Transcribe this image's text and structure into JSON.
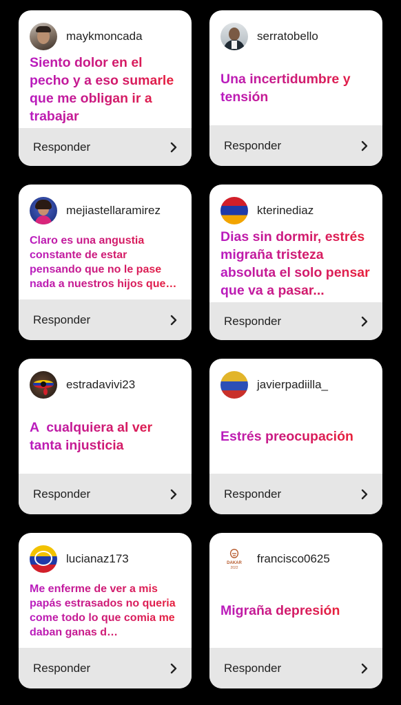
{
  "reply_label": "Responder",
  "accent_gradient": [
    "#b81bc0",
    "#d11a6c",
    "#e8213a"
  ],
  "cards": [
    {
      "username": "maykmoncada",
      "message": "Siento dolor en el pecho y a eso sumarle que me obligan ir a trabajar",
      "avatar_icon": "user-photo"
    },
    {
      "username": "serratobello",
      "message": "Una incertidumbre y tensión",
      "avatar_icon": "user-photo"
    },
    {
      "username": "mejiastellaramirez",
      "message": "Claro es una angustia constante de estar pensando que no le pase nada a nuestros hijos que…",
      "avatar_icon": "user-photo"
    },
    {
      "username": "kterinediaz",
      "message": "Dias sin dormir, estrés migraña tristeza absoluta el solo pensar que va a pasar...",
      "avatar_icon": "flag-icon"
    },
    {
      "username": "estradavivi23",
      "message": "A  cualquiera al ver tanta injusticia",
      "avatar_icon": "eye-flag-icon"
    },
    {
      "username": "javierpadiilla_",
      "message": "Estrés preocupación",
      "avatar_icon": "flag-icon"
    },
    {
      "username": "lucianaz173",
      "message": "Me enferme de ver a mis papás estrasados no queria come todo lo que comia me daban ganas d…",
      "avatar_icon": "flag-icon"
    },
    {
      "username": "francisco0625",
      "message": "Migraña depresión",
      "avatar_icon": "dakar-logo-icon",
      "avatar_text": [
        "DAKAR",
        "2022"
      ]
    }
  ]
}
